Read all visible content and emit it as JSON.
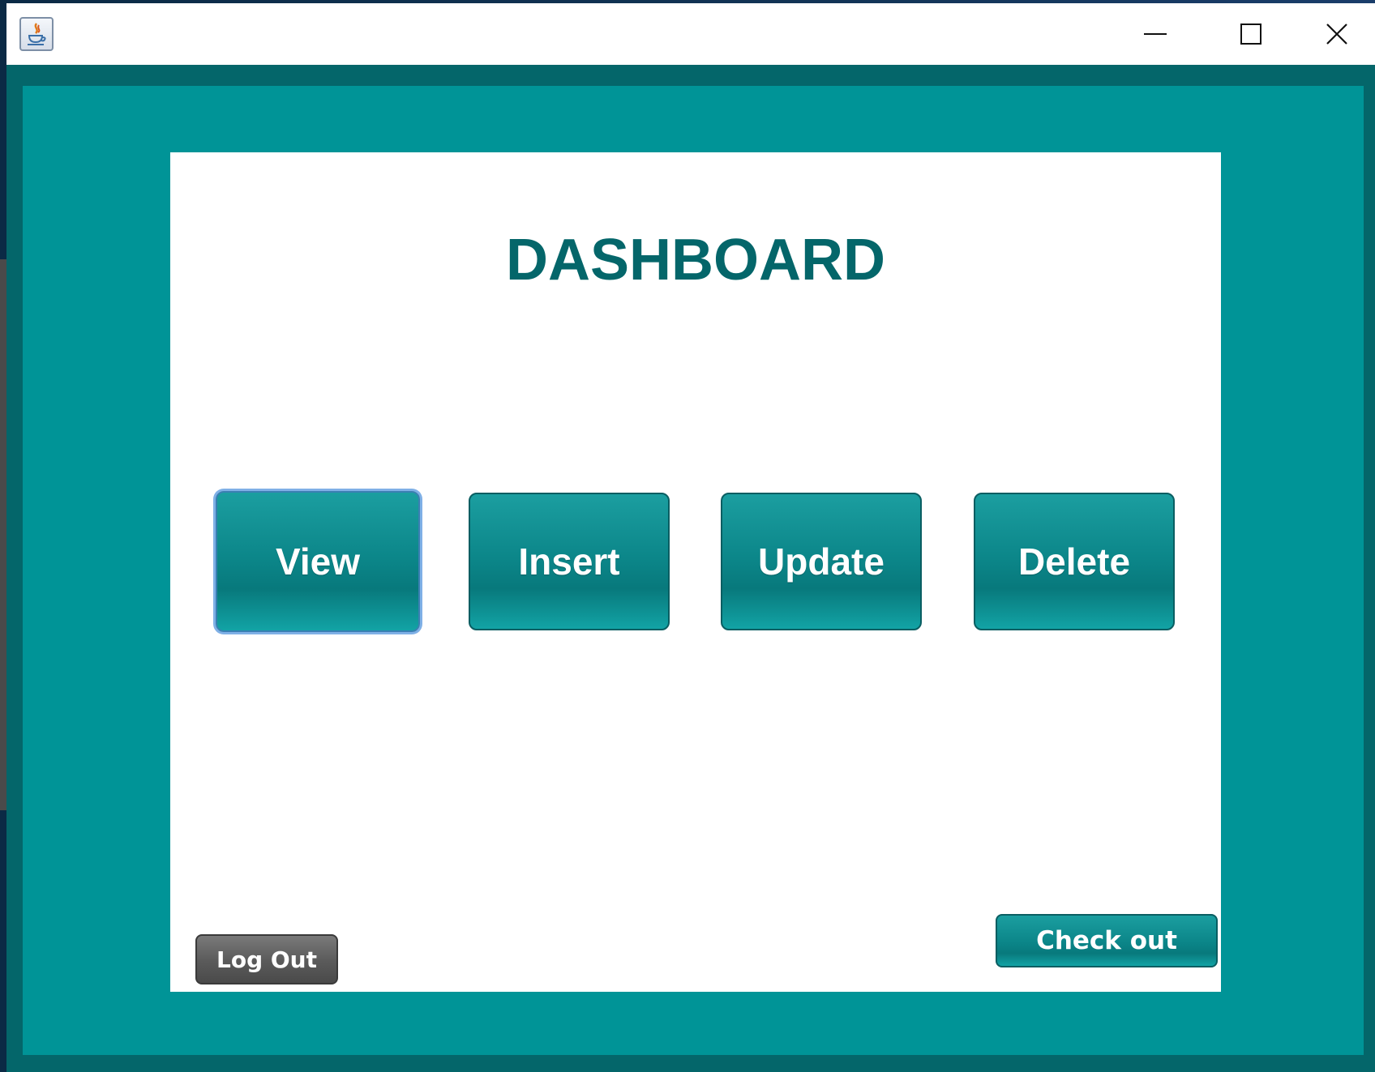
{
  "window": {
    "icon": "java-cup-icon",
    "controls": [
      "minimize-icon",
      "maximize-icon",
      "close-icon"
    ]
  },
  "dashboard": {
    "title": "DASHBOARD",
    "buttons": {
      "view": "View",
      "insert": "Insert",
      "update": "Update",
      "delete": "Delete"
    },
    "logout": "Log Out",
    "checkout": "Check out"
  },
  "colors": {
    "panel": "#009497",
    "frame": "#04666a",
    "title": "#04666a",
    "button": "#0b8588",
    "logout": "#5a5a5a"
  }
}
